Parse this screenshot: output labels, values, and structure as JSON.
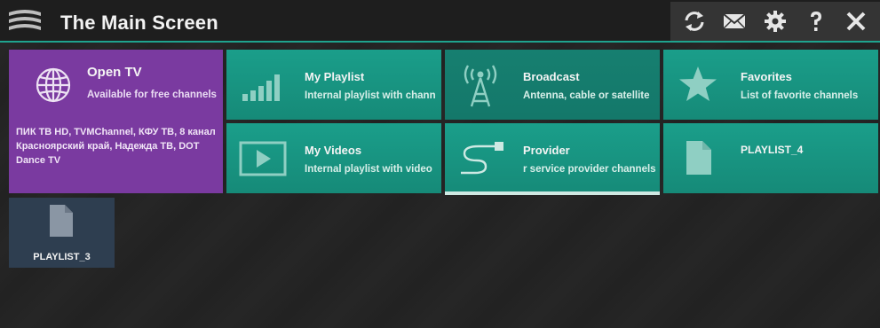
{
  "header": {
    "title": "The Main Screen",
    "accent_color": "#1fa38e",
    "actions": [
      {
        "icon": "sync-icon"
      },
      {
        "icon": "mail-icon"
      },
      {
        "icon": "gear-icon"
      },
      {
        "icon": "help-icon"
      },
      {
        "icon": "close-icon"
      }
    ]
  },
  "tiles": {
    "open_tv": {
      "title": "Open TV",
      "subtitle": "Available for free channels",
      "description": "ПИК ТВ HD, TVMChannel, КФУ ТВ, 8 канал Красноярский край, Надежда ТВ, DOT Dance TV",
      "icon": "globe-icon",
      "color": "#7a3aa0"
    },
    "my_playlist": {
      "title": "My Playlist",
      "subtitle": "Internal playlist with chann",
      "icon": "signal-bars-icon"
    },
    "broadcast": {
      "title": "Broadcast",
      "subtitle": "Antenna, cable or satellite",
      "icon": "antenna-icon"
    },
    "favorites": {
      "title": "Favorites",
      "subtitle": "List of favorite channels",
      "icon": "star-icon"
    },
    "my_videos": {
      "title": "My Videos",
      "subtitle": "Internal playlist with video",
      "icon": "video-play-icon"
    },
    "provider": {
      "title": "Provider",
      "subtitle": "r service provider channels",
      "icon": "cable-plug-icon"
    },
    "playlist_4": {
      "title": "PLAYLIST_4",
      "icon": "document-icon"
    },
    "playlist_3": {
      "title": "PLAYLIST_3",
      "icon": "document-icon",
      "color": "#2e3e50"
    }
  }
}
